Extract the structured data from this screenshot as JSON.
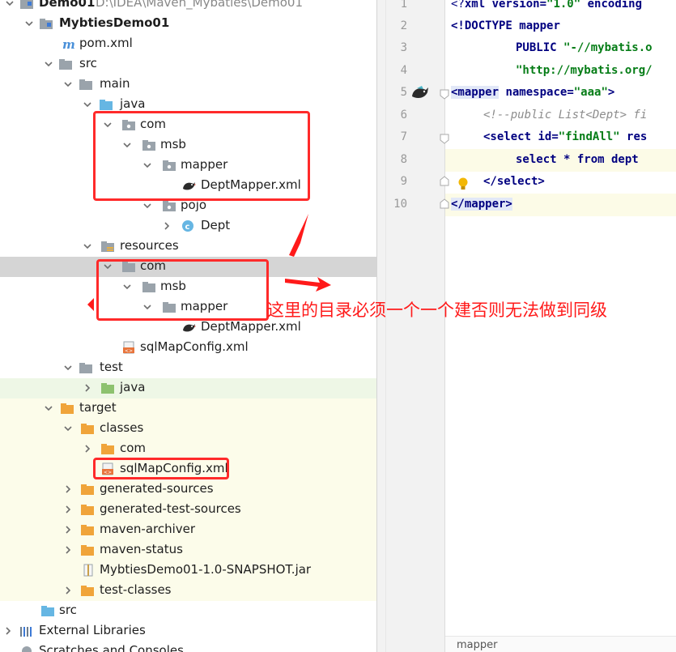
{
  "project": {
    "name": "Demo01",
    "path": "D:\\IDEA\\Maven_Mybaties\\Demo01"
  },
  "tree": {
    "module": "MybtiesDemo01",
    "pom": "pom.xml",
    "src": "src",
    "main": "main",
    "java": "java",
    "com": "com",
    "msb": "msb",
    "mapper": "mapper",
    "dept_mapper_xml": "DeptMapper.xml",
    "pojo": "pojo",
    "dept": "Dept",
    "resources": "resources",
    "res_com": "com",
    "res_msb": "msb",
    "res_mapper": "mapper",
    "res_dept_mapper_xml": "DeptMapper.xml",
    "sqlmapconfig": "sqlMapConfig.xml",
    "test": "test",
    "test_java": "java",
    "target": "target",
    "classes": "classes",
    "classes_com": "com",
    "classes_sqlmapconfig": "sqlMapConfig.xml",
    "generated_sources": "generated-sources",
    "generated_test_sources": "generated-test-sources",
    "maven_archiver": "maven-archiver",
    "maven_status": "maven-status",
    "jar": "MybtiesDemo01-1.0-SNAPSHOT.jar",
    "test_classes": "test-classes",
    "root_src": "src",
    "external_libraries": "External Libraries",
    "scratches": "Scratches and Consoles"
  },
  "editor": {
    "line_numbers": [
      "1",
      "2",
      "3",
      "4",
      "5",
      "6",
      "7",
      "8",
      "9",
      "10"
    ],
    "l1_a": "<?",
    "l1_b": "xml version",
    "l1_c": "=",
    "l1_d": "\"1.0\"",
    "l1_e": " encoding",
    "l2_a": "<!DOCTYPE ",
    "l2_b": "mapper",
    "l3_a": "PUBLIC ",
    "l3_b": "\"-//mybatis.o",
    "l4_a": "\"http://mybatis.org/",
    "l5_a": "<mapper",
    "l5_b": " namespace",
    "l5_c": "=",
    "l5_d": "\"aaa\"",
    "l5_e": ">",
    "l6_a": "<!--public List<Dept> fi",
    "l7_a": "<select",
    "l7_b": " id",
    "l7_c": "=",
    "l7_d": "\"findAll\"",
    "l7_e": " res",
    "l8_a": "select * from dept",
    "l9_a": "</select>",
    "l10_a": "</mapper>",
    "breadcrumb": "mapper"
  },
  "annotation": {
    "note": "这里的目录必须一个一个建否则无法做到同级",
    "color": "#ff1a1a"
  },
  "colors": {
    "folder": "#f0a43a",
    "java_folder": "#66b6e3",
    "test_folder": "#8dc26f",
    "package": "#9aa3ab",
    "selection": "#d5d5d5"
  }
}
